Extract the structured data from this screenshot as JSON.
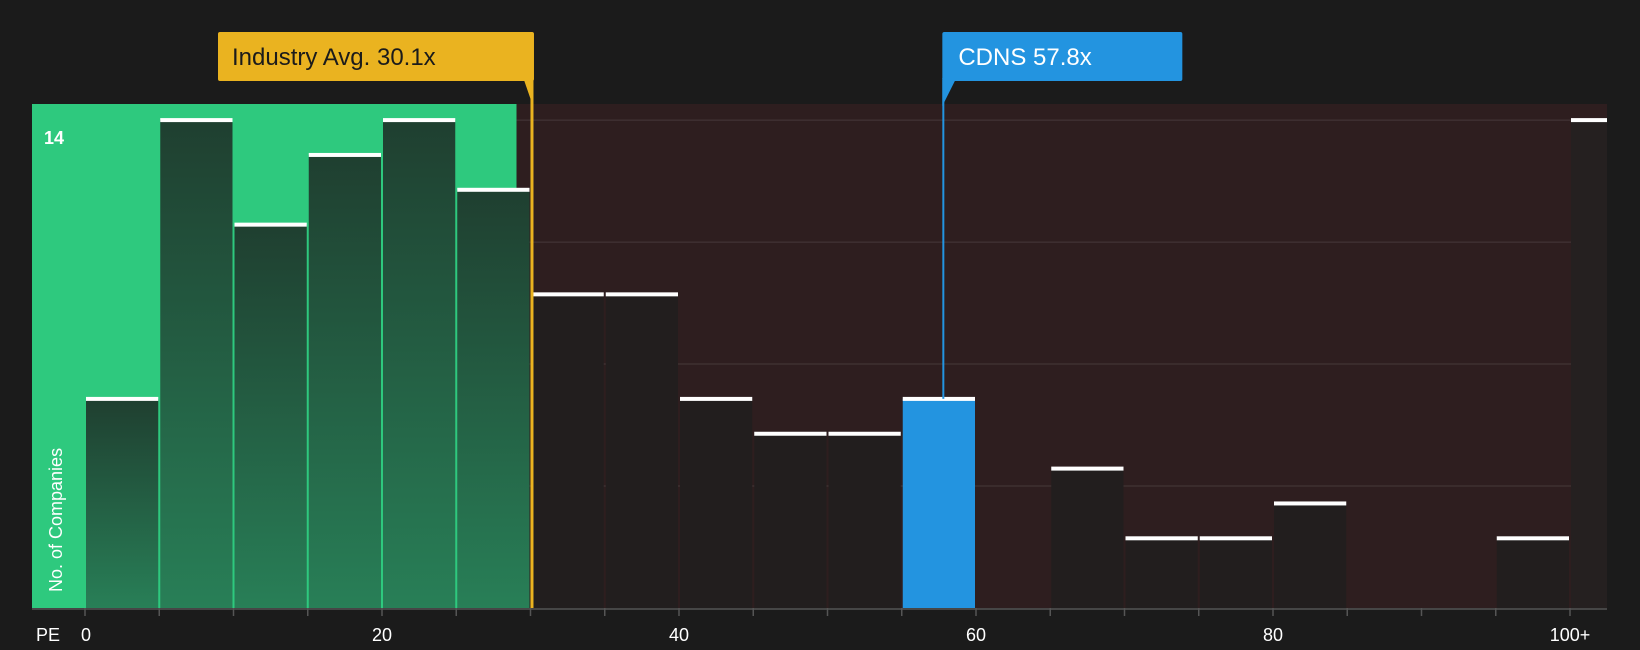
{
  "chart_data": {
    "type": "bar",
    "xlabel": "PE",
    "ylabel": "No. of Companies",
    "y_max_label": "14",
    "ylim": [
      0,
      14.5
    ],
    "xlim": [
      0,
      102.5
    ],
    "bin_width": 5,
    "x_ticks": [
      {
        "value": 0,
        "label": "0"
      },
      {
        "value": 20,
        "label": "20"
      },
      {
        "value": 40,
        "label": "40"
      },
      {
        "value": 60,
        "label": "60"
      },
      {
        "value": 80,
        "label": "80"
      },
      {
        "value": 100,
        "label": "100+"
      }
    ],
    "bins": [
      {
        "start": 0,
        "value": 6
      },
      {
        "start": 5,
        "value": 14
      },
      {
        "start": 10,
        "value": 11
      },
      {
        "start": 15,
        "value": 13
      },
      {
        "start": 20,
        "value": 14
      },
      {
        "start": 25,
        "value": 12
      },
      {
        "start": 30,
        "value": 9
      },
      {
        "start": 35,
        "value": 9
      },
      {
        "start": 40,
        "value": 6
      },
      {
        "start": 45,
        "value": 5
      },
      {
        "start": 50,
        "value": 5
      },
      {
        "start": 55,
        "value": 6
      },
      {
        "start": 60,
        "value": 0
      },
      {
        "start": 65,
        "value": 4
      },
      {
        "start": 70,
        "value": 2
      },
      {
        "start": 75,
        "value": 2
      },
      {
        "start": 80,
        "value": 3
      },
      {
        "start": 85,
        "value": 0
      },
      {
        "start": 90,
        "value": 0
      },
      {
        "start": 95,
        "value": 2
      },
      {
        "start": 100,
        "value": 14
      }
    ],
    "industry_avg": {
      "value": 30.1,
      "label": "Industry Avg. 30.1x"
    },
    "company": {
      "value": 57.8,
      "label": "CDNS 57.8x",
      "bin_start": 55
    },
    "colors": {
      "background": "#1b1b1b",
      "undervalued_zone": "#2ec97e",
      "overvalued_zone": "#2e1e1f",
      "industry": "#eab320",
      "company": "#2394e0",
      "bar_top": "#ffffff"
    }
  }
}
